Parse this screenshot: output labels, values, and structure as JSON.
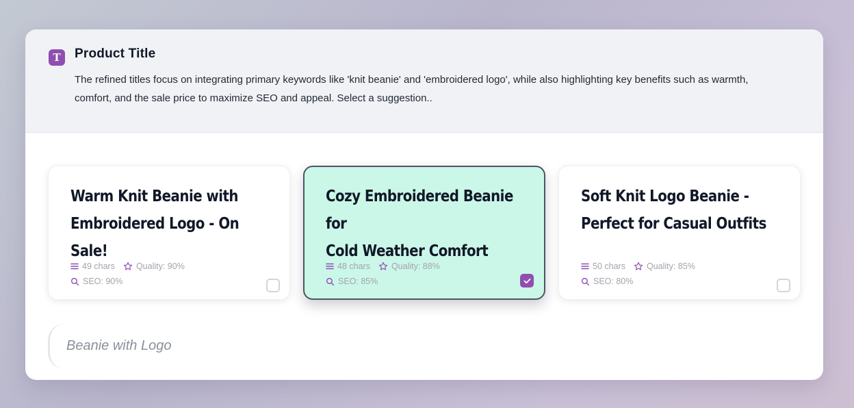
{
  "header": {
    "icon": "text-t-icon",
    "title": "Product Title",
    "description": "The refined titles focus on integrating primary keywords like 'knit beanie' and 'embroidered logo', while also highlighting key benefits such as warmth, comfort, and the sale price to maximize SEO and appeal. Select a suggestion.."
  },
  "suggestions": [
    {
      "title_line1": "Warm Knit Beanie with",
      "title_line2": "Embroidered Logo - On Sale!",
      "chars": "49 chars",
      "quality": "Quality: 90%",
      "seo": "SEO: 90%",
      "selected": false
    },
    {
      "title_line1": "Cozy Embroidered Beanie for",
      "title_line2": "Cold Weather Comfort",
      "chars": "48 chars",
      "quality": "Quality: 88%",
      "seo": "SEO: 85%",
      "selected": true
    },
    {
      "title_line1": "Soft Knit Logo Beanie -",
      "title_line2": "Perfect for Casual Outfits",
      "chars": "50 chars",
      "quality": "Quality: 85%",
      "seo": "SEO: 80%",
      "selected": false
    }
  ],
  "input": {
    "placeholder": "Beanie with Logo"
  },
  "colors": {
    "accent": "#8e4fb0",
    "selected_bg": "#cbf7e8"
  }
}
